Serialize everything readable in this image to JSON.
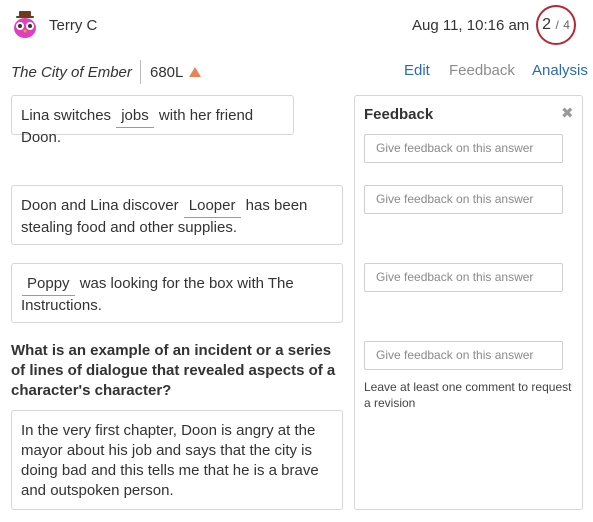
{
  "header": {
    "username": "Terry C",
    "avatar_icon": "owl-avatar-icon",
    "timestamp": "Aug 11, 10:16 am",
    "score": {
      "current": "2",
      "separator": "/",
      "total": "4"
    },
    "score_color": "#b32a37"
  },
  "book": {
    "title": "The City of Ember",
    "lexile": "680L",
    "lexile_icon": "triangle-up-icon"
  },
  "nav": {
    "edit": "Edit",
    "feedback": "Feedback",
    "analysis": "Analysis"
  },
  "answers": [
    {
      "before": "Lina switches",
      "blank": "jobs",
      "after": "with her friend Doon."
    },
    {
      "before": "Doon and Lina discover",
      "blank": "Looper",
      "after": "has been stealing food and other supplies."
    },
    {
      "before": "",
      "blank": "Poppy",
      "after": "was looking for the box with The Instructions."
    }
  ],
  "question": {
    "prompt": "What is an example of an incident or a series of lines of dialogue that revealed aspects of a character's character?",
    "response": "In the very first chapter, Doon is angry at the mayor about his job and says that the city is doing bad and this tells me that he is a brave and outspoken person."
  },
  "feedback_panel": {
    "title": "Feedback",
    "close_icon": "close-icon",
    "placeholder": "Give feedback on this answer",
    "note": "Leave at least one comment to request a revision"
  },
  "colors": {
    "link": "#2a6ab1",
    "muted": "#8c8c8c",
    "lexile_icon": "#e8845a"
  }
}
